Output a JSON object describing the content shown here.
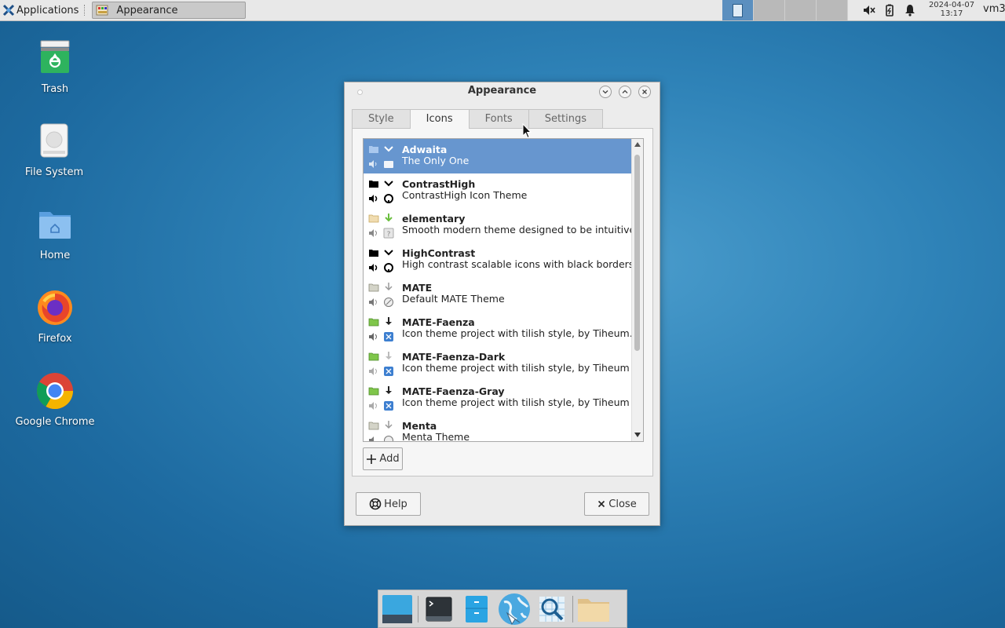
{
  "top_panel": {
    "applications_label": "Applications",
    "task_button_label": "Appearance",
    "clock_date": "2024-04-07",
    "clock_time": "13:17",
    "user_label": "vm3"
  },
  "desktop": {
    "icons": [
      {
        "label": "Trash",
        "icon": "trash-icon"
      },
      {
        "label": "File System",
        "icon": "drive-icon"
      },
      {
        "label": "Home",
        "icon": "home-folder-icon"
      },
      {
        "label": "Firefox",
        "icon": "firefox-icon"
      },
      {
        "label": "Google Chrome",
        "icon": "chrome-icon"
      }
    ]
  },
  "window": {
    "title": "Appearance",
    "tabs": [
      {
        "label": "Style"
      },
      {
        "label": "Icons",
        "active": true
      },
      {
        "label": "Fonts"
      },
      {
        "label": "Settings"
      }
    ],
    "themes": [
      {
        "name": "Adwaita",
        "desc": "The Only One",
        "selected": true
      },
      {
        "name": "ContrastHigh",
        "desc": "ContrastHigh Icon Theme"
      },
      {
        "name": "elementary",
        "desc": "Smooth modern theme designed to be intuitive."
      },
      {
        "name": "HighContrast",
        "desc": "High contrast scalable icons with black borders"
      },
      {
        "name": "MATE",
        "desc": "Default MATE Theme"
      },
      {
        "name": "MATE-Faenza",
        "desc": "Icon theme project with tilish style, by Tiheum. M."
      },
      {
        "name": "MATE-Faenza-Dark",
        "desc": "Icon theme project with tilish style, by Tiheum"
      },
      {
        "name": "MATE-Faenza-Gray",
        "desc": "Icon theme project with tilish style, by Tiheum"
      },
      {
        "name": "Menta",
        "desc": "Menta Theme"
      }
    ],
    "add_label": "Add",
    "help_label": "Help",
    "close_label": "Close"
  },
  "dock": {
    "items": [
      "show-desktop-icon",
      "terminal-icon",
      "file-manager-icon",
      "web-browser-icon",
      "app-finder-icon",
      "folder-icon"
    ]
  },
  "colors": {
    "selection": "#6796cf",
    "desktop_background": "#2f83b8"
  }
}
